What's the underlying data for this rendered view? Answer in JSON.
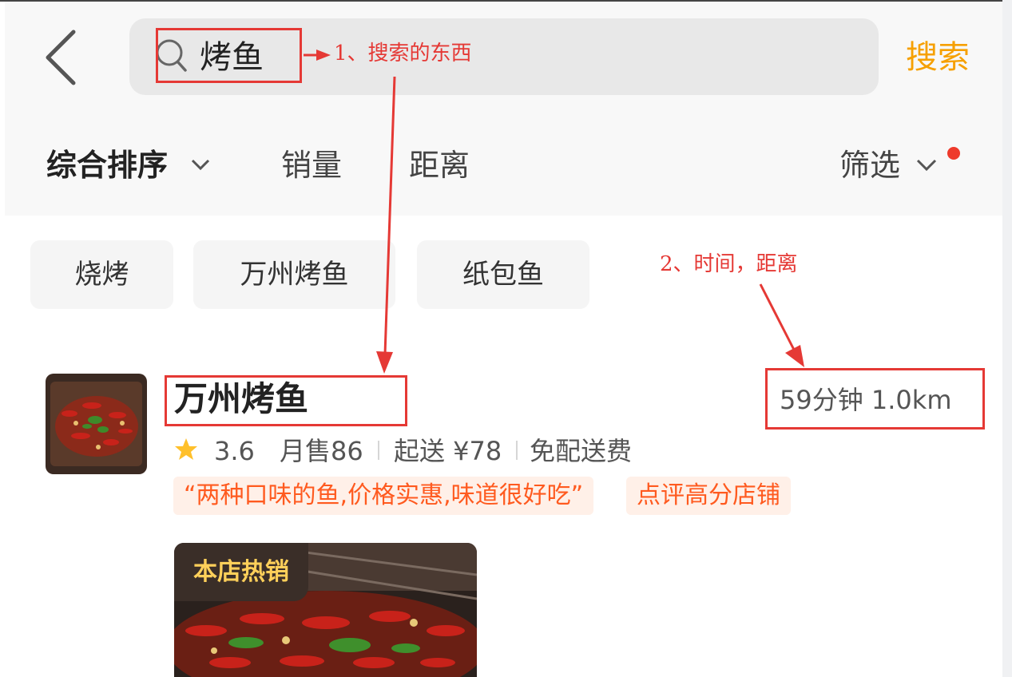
{
  "search": {
    "query": "烤鱼",
    "button_label": "搜索"
  },
  "sort_bar": {
    "main_label": "综合排序",
    "sales_label": "销量",
    "distance_label": "距离",
    "filter_label": "筛选"
  },
  "chips": [
    "烧烤",
    "万州烤鱼",
    "纸包鱼"
  ],
  "store": {
    "name": "万州烤鱼",
    "eta": "59分钟   1.0km",
    "rating": "3.6",
    "monthly_sales": "月售86",
    "min_order": "起送 ¥78",
    "delivery_fee": "免配送费",
    "review_tag": "“两种口味的鱼,价格实惠,味道很好吃”",
    "badge_tag": "点评高分店铺",
    "featured_badge": "本店热销"
  },
  "annotations": {
    "note1": "1、搜索的东西",
    "note2": "2、时间，距离"
  },
  "icons": {
    "back": "chevron-left-icon",
    "search": "search-icon",
    "sort_chevron": "chevron-down-icon",
    "filter_chevron": "chevron-down-icon",
    "rating_star": "star-icon"
  },
  "colors": {
    "accent": "#f6a000",
    "annotation": "#e53935",
    "tag_text": "#ff5a1f",
    "tag_bg": "#fff0e8",
    "star": "#ffc02b",
    "filter_dot": "#ee3a2b"
  }
}
